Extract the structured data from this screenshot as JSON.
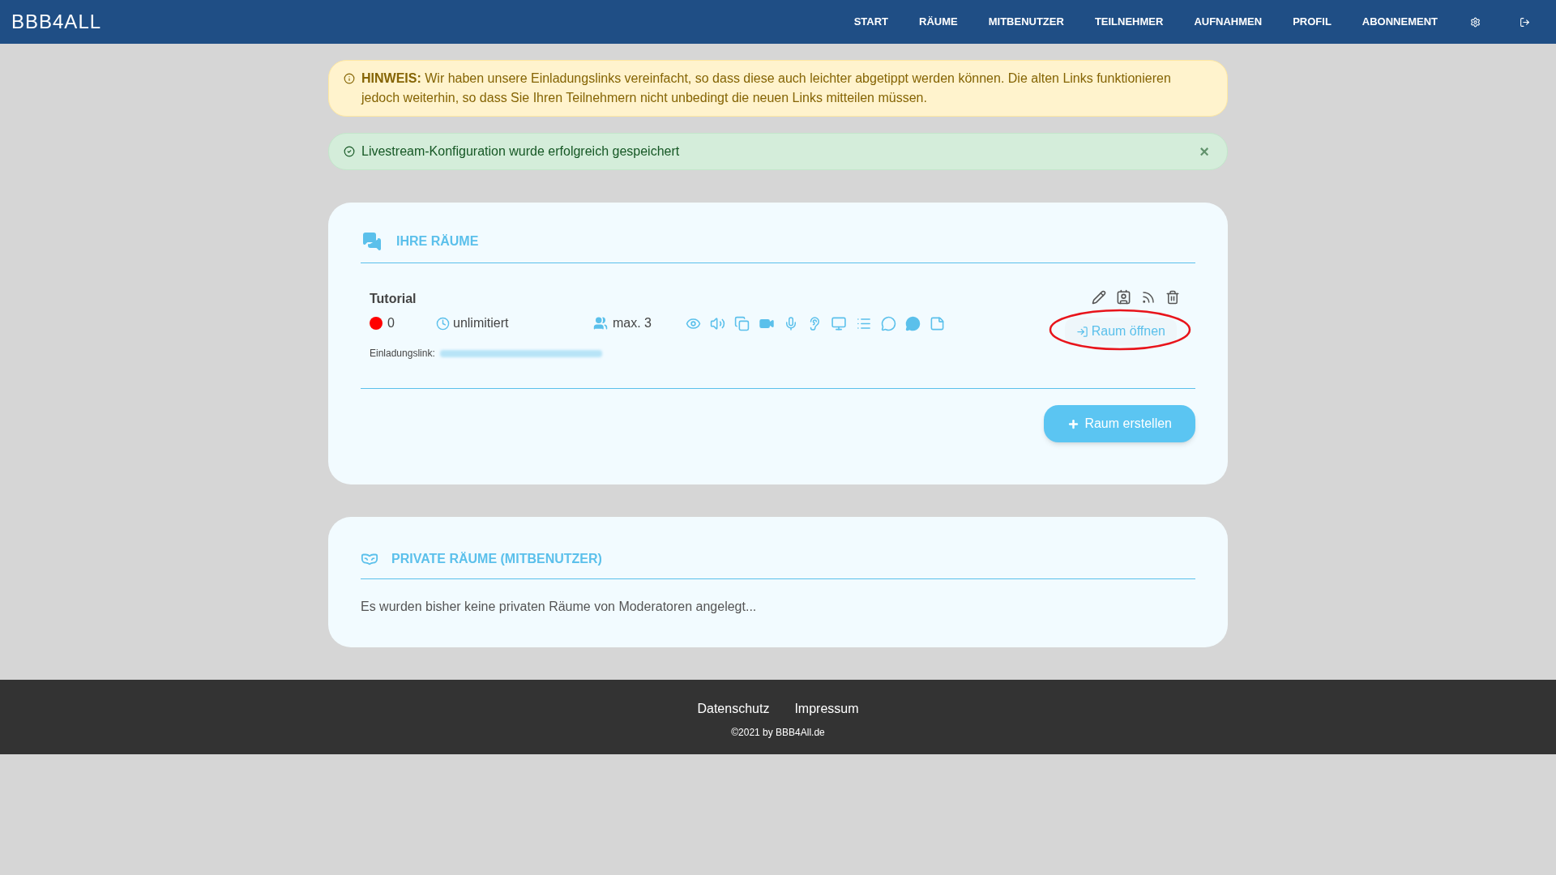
{
  "navbar": {
    "logo": "BBB4ALL",
    "items": [
      "START",
      "RÄUME",
      "MITBENUTZER",
      "TEILNEHMER",
      "AUFNAHMEN",
      "PROFIL",
      "ABONNEMENT"
    ]
  },
  "alerts": [
    {
      "kind": "warning",
      "title": "HINWEIS:",
      "text": "Wir haben unsere Einladungslinks vereinfacht, so dass diese auch leichter abgetippt werden können. Die alten Links funktionieren jedoch weiterhin, so dass Sie Ihren Teilnehmern nicht unbedingt die neuen Links mitteilen müssen."
    },
    {
      "kind": "success",
      "text": "Livestream-Konfiguration wurde erfolgreich gespeichert",
      "close": "×"
    }
  ],
  "my_rooms": {
    "title": "IHRE RÄUME",
    "rooms": [
      {
        "name": "Tutorial",
        "color": "#ff0000",
        "participants": "0",
        "duration": "unlimitiert",
        "max": "max. 3",
        "link_label": "Einladungslink:",
        "open_button": "Raum öffnen"
      }
    ],
    "create_button": "Raum erstellen"
  },
  "private_rooms": {
    "title": "PRIVATE RÄUME (MITBENUTZER)",
    "empty_text": "Es wurden bisher keine privaten Räume von Moderatoren angelegt..."
  },
  "footer": {
    "links": [
      "Datenschutz",
      "Impressum"
    ],
    "copyright": "©2021 by BBB4All.de"
  }
}
